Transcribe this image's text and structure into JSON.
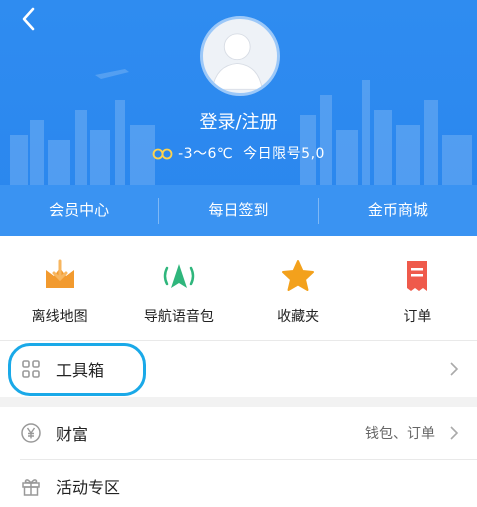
{
  "header": {
    "login_label": "登录/注册",
    "weather_temp": "-3～6℃",
    "weather_restriction": "今日限号5,0"
  },
  "quick_nav": [
    "会员中心",
    "每日签到",
    "金币商城"
  ],
  "features": [
    {
      "label": "离线地图",
      "icon": "offline-map-icon",
      "color": "#f29a2e"
    },
    {
      "label": "导航语音包",
      "icon": "voice-pack-icon",
      "color": "#2fb67c"
    },
    {
      "label": "收藏夹",
      "icon": "star-icon",
      "color": "#f3a11c"
    },
    {
      "label": "订单",
      "icon": "order-icon",
      "color": "#ef5a4b"
    }
  ],
  "menu": {
    "toolbox": {
      "label": "工具箱"
    },
    "wealth": {
      "label": "财富",
      "right": "钱包、订单"
    },
    "activity": {
      "label": "活动专区"
    }
  },
  "colors": {
    "header_blue": "#2f8cf0",
    "highlight": "#1aa9e8"
  }
}
